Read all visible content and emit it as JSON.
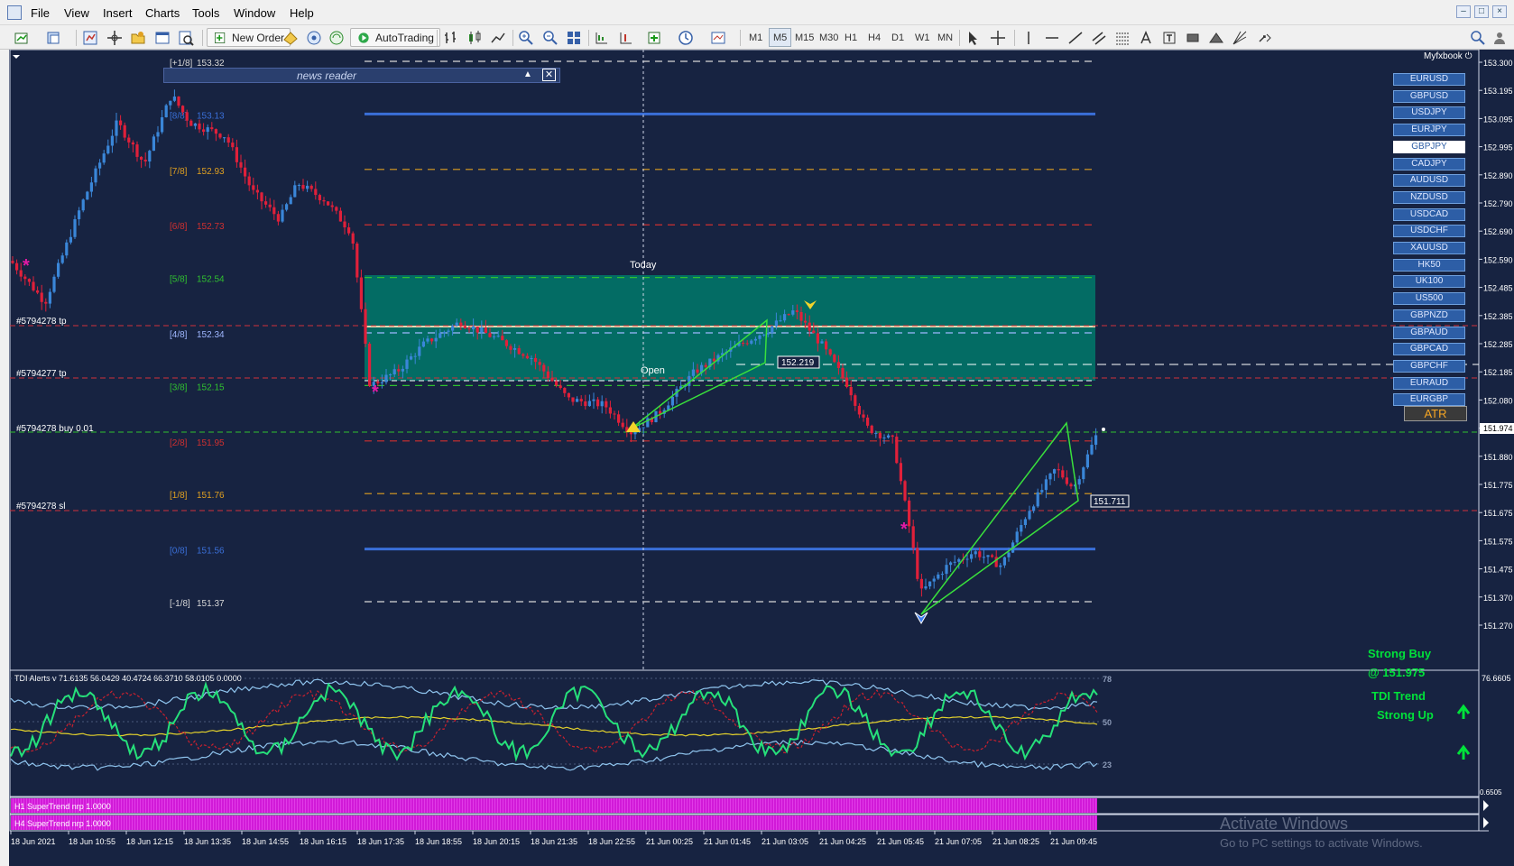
{
  "window": {
    "menu": [
      "File",
      "View",
      "Insert",
      "Charts",
      "Tools",
      "Window",
      "Help"
    ],
    "controls": [
      "–",
      "□",
      "×"
    ]
  },
  "toolbar": {
    "new_order": "New Order",
    "autotrading": "AutoTrading",
    "timeframes": [
      "M1",
      "M5",
      "M15",
      "M30",
      "H1",
      "H4",
      "D1",
      "W1",
      "MN"
    ],
    "active_timeframe": "M5"
  },
  "chart": {
    "today_label": "Today",
    "open_label": "Open",
    "news_reader": "news reader",
    "myfxbook": "Myfxbook",
    "murrey_levels": [
      {
        "name": "[+1/8]",
        "price": "153.32",
        "color": "#d8d8d8"
      },
      {
        "name": "[8/8]",
        "price": "153.13",
        "color": "#3a6fd8"
      },
      {
        "name": "[7/8]",
        "price": "152.93",
        "color": "#e0a020"
      },
      {
        "name": "[6/8]",
        "price": "152.73",
        "color": "#d03030"
      },
      {
        "name": "[5/8]",
        "price": "152.54",
        "color": "#30c030"
      },
      {
        "name": "[4/8]",
        "price": "152.34",
        "color": "#9fb7ff"
      },
      {
        "name": "[3/8]",
        "price": "152.15",
        "color": "#30c030"
      },
      {
        "name": "[2/8]",
        "price": "151.95",
        "color": "#d03030"
      },
      {
        "name": "[1/8]",
        "price": "151.76",
        "color": "#e0a020"
      },
      {
        "name": "[0/8]",
        "price": "151.56",
        "color": "#3a6fd8"
      },
      {
        "name": "[-1/8]",
        "price": "151.37",
        "color": "#d8d8d8"
      }
    ],
    "order_labels": [
      {
        "text": "#5794278 tp"
      },
      {
        "text": "#5794277 tp"
      },
      {
        "text": "#5794278 buy 0.01"
      },
      {
        "text": "#5794278 sl"
      }
    ],
    "price_tags": [
      "152.219",
      "151.711"
    ],
    "price_axis": [
      "153.300",
      "153.195",
      "153.095",
      "152.995",
      "152.890",
      "152.790",
      "152.690",
      "152.590",
      "152.485",
      "152.385",
      "152.285",
      "152.185",
      "152.080",
      "151.974",
      "151.880",
      "151.775",
      "151.675",
      "151.575",
      "151.475",
      "151.370",
      "151.270"
    ],
    "current_price": "151.974",
    "time_axis": [
      "18 Jun 2021",
      "18 Jun 10:55",
      "18 Jun 12:15",
      "18 Jun 13:35",
      "18 Jun 14:55",
      "18 Jun 16:15",
      "18 Jun 17:35",
      "18 Jun 18:55",
      "18 Jun 20:15",
      "18 Jun 21:35",
      "18 Jun 22:55",
      "21 Jun 00:25",
      "21 Jun 01:45",
      "21 Jun 03:05",
      "21 Jun 04:25",
      "21 Jun 05:45",
      "21 Jun 07:05",
      "21 Jun 08:25",
      "21 Jun 09:45"
    ]
  },
  "symbols": [
    "EURUSD",
    "GBPUSD",
    "USDJPY",
    "EURJPY",
    "GBPJPY",
    "CADJPY",
    "AUDUSD",
    "NZDUSD",
    "USDCAD",
    "USDCHF",
    "XAUUSD",
    "HK50",
    "UK100",
    "US500",
    "GBPNZD",
    "GBPAUD",
    "GBPCAD",
    "GBPCHF",
    "EURAUD",
    "EURGBP"
  ],
  "active_symbol": "GBPJPY",
  "atr_label": "ATR",
  "tdi": {
    "header": "TDI Alerts v 71.6135 56.0429 40.4724 66.3710 58.0105 0.0000",
    "levels": [
      "78",
      "50",
      "23"
    ],
    "axis_top": "76.6605",
    "axis_bottom": "0.6505",
    "signal1_line1": "Strong Buy",
    "signal1_line2": "@ 151.975",
    "signal2_line1": "TDI Trend",
    "signal2_line2": "Strong Up"
  },
  "supertrend": {
    "h1": "H1  SuperTrend nrp 1.0000",
    "h4": "H4  SuperTrend nrp 1.0000"
  },
  "watermark": {
    "line1": "Activate Windows",
    "line2": "Go to PC settings to activate Windows."
  },
  "colors": {
    "background": "#172341",
    "bull": "#3a86d8",
    "bear": "#e0203a",
    "zone": "#00796b",
    "signal": "#00e23a"
  }
}
